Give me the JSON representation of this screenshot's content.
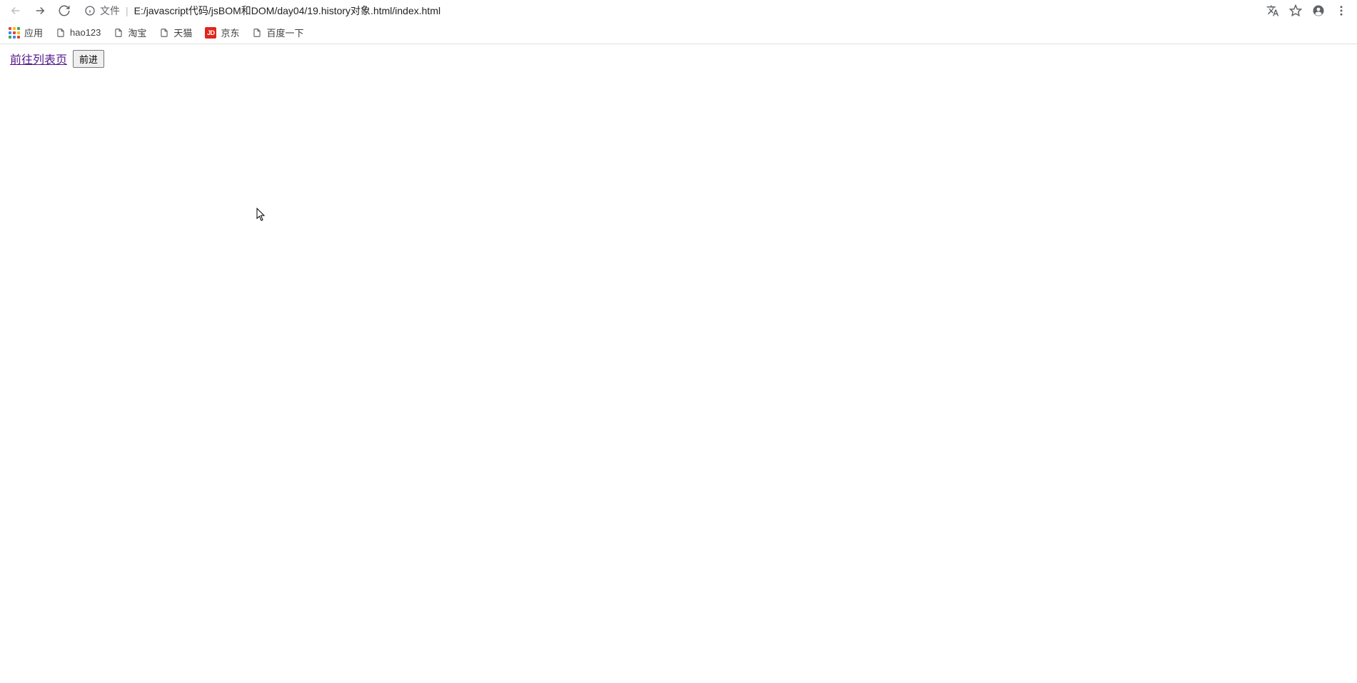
{
  "toolbar": {
    "address_prefix": "文件",
    "address_separator": "|",
    "address_url": "E:/javascript代码/jsBOM和DOM/day04/19.history对象.html/index.html"
  },
  "bookmarks": {
    "apps": "应用",
    "items": [
      {
        "label": "hao123",
        "favicon": "page"
      },
      {
        "label": "淘宝",
        "favicon": "page"
      },
      {
        "label": "天猫",
        "favicon": "page"
      },
      {
        "label": "京东",
        "favicon": "jd"
      },
      {
        "label": "百度一下",
        "favicon": "page"
      }
    ]
  },
  "page": {
    "link_text": "前往列表页",
    "button_text": "前进"
  }
}
